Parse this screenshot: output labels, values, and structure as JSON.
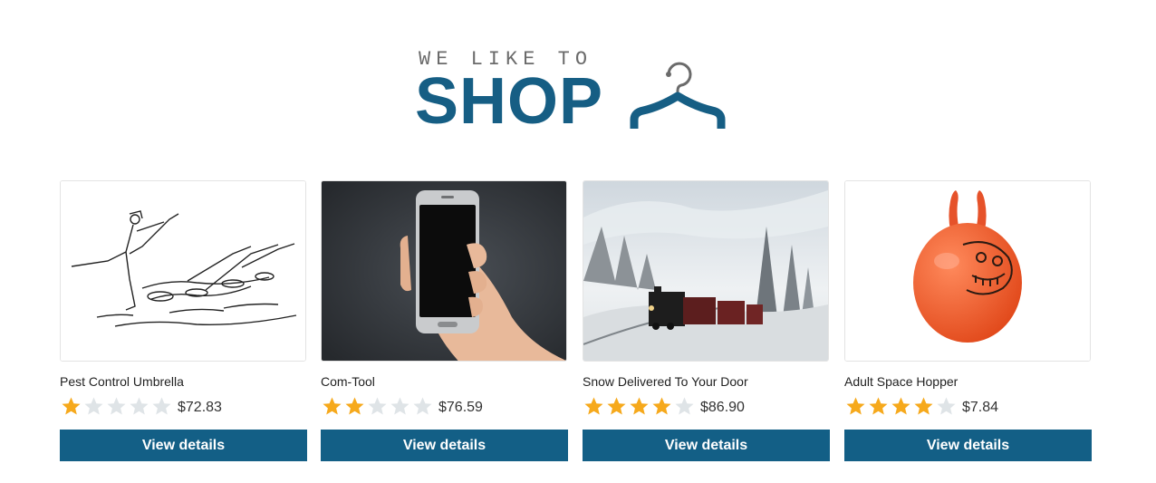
{
  "logo": {
    "tagline": "WE LIKE TO",
    "wordmark": "SHOP",
    "brand_color": "#165e84"
  },
  "products": [
    {
      "title": "Pest Control Umbrella",
      "rating": 1,
      "price": "$72.83",
      "button_label": "View details",
      "image": "man-with-umbrella-and-cats-sketch"
    },
    {
      "title": "Com-Tool",
      "rating": 2,
      "price": "$76.59",
      "button_label": "View details",
      "image": "hand-holding-phone"
    },
    {
      "title": "Snow Delivered To Your Door",
      "rating": 4,
      "price": "$86.90",
      "button_label": "View details",
      "image": "steam-train-in-snow"
    },
    {
      "title": "Adult Space Hopper",
      "rating": 4,
      "price": "$7.84",
      "button_label": "View details",
      "image": "orange-space-hopper"
    }
  ],
  "rating_max": 5,
  "colors": {
    "star_filled": "#f6a91c",
    "star_empty": "#dfe4e7",
    "button": "#135f86"
  }
}
